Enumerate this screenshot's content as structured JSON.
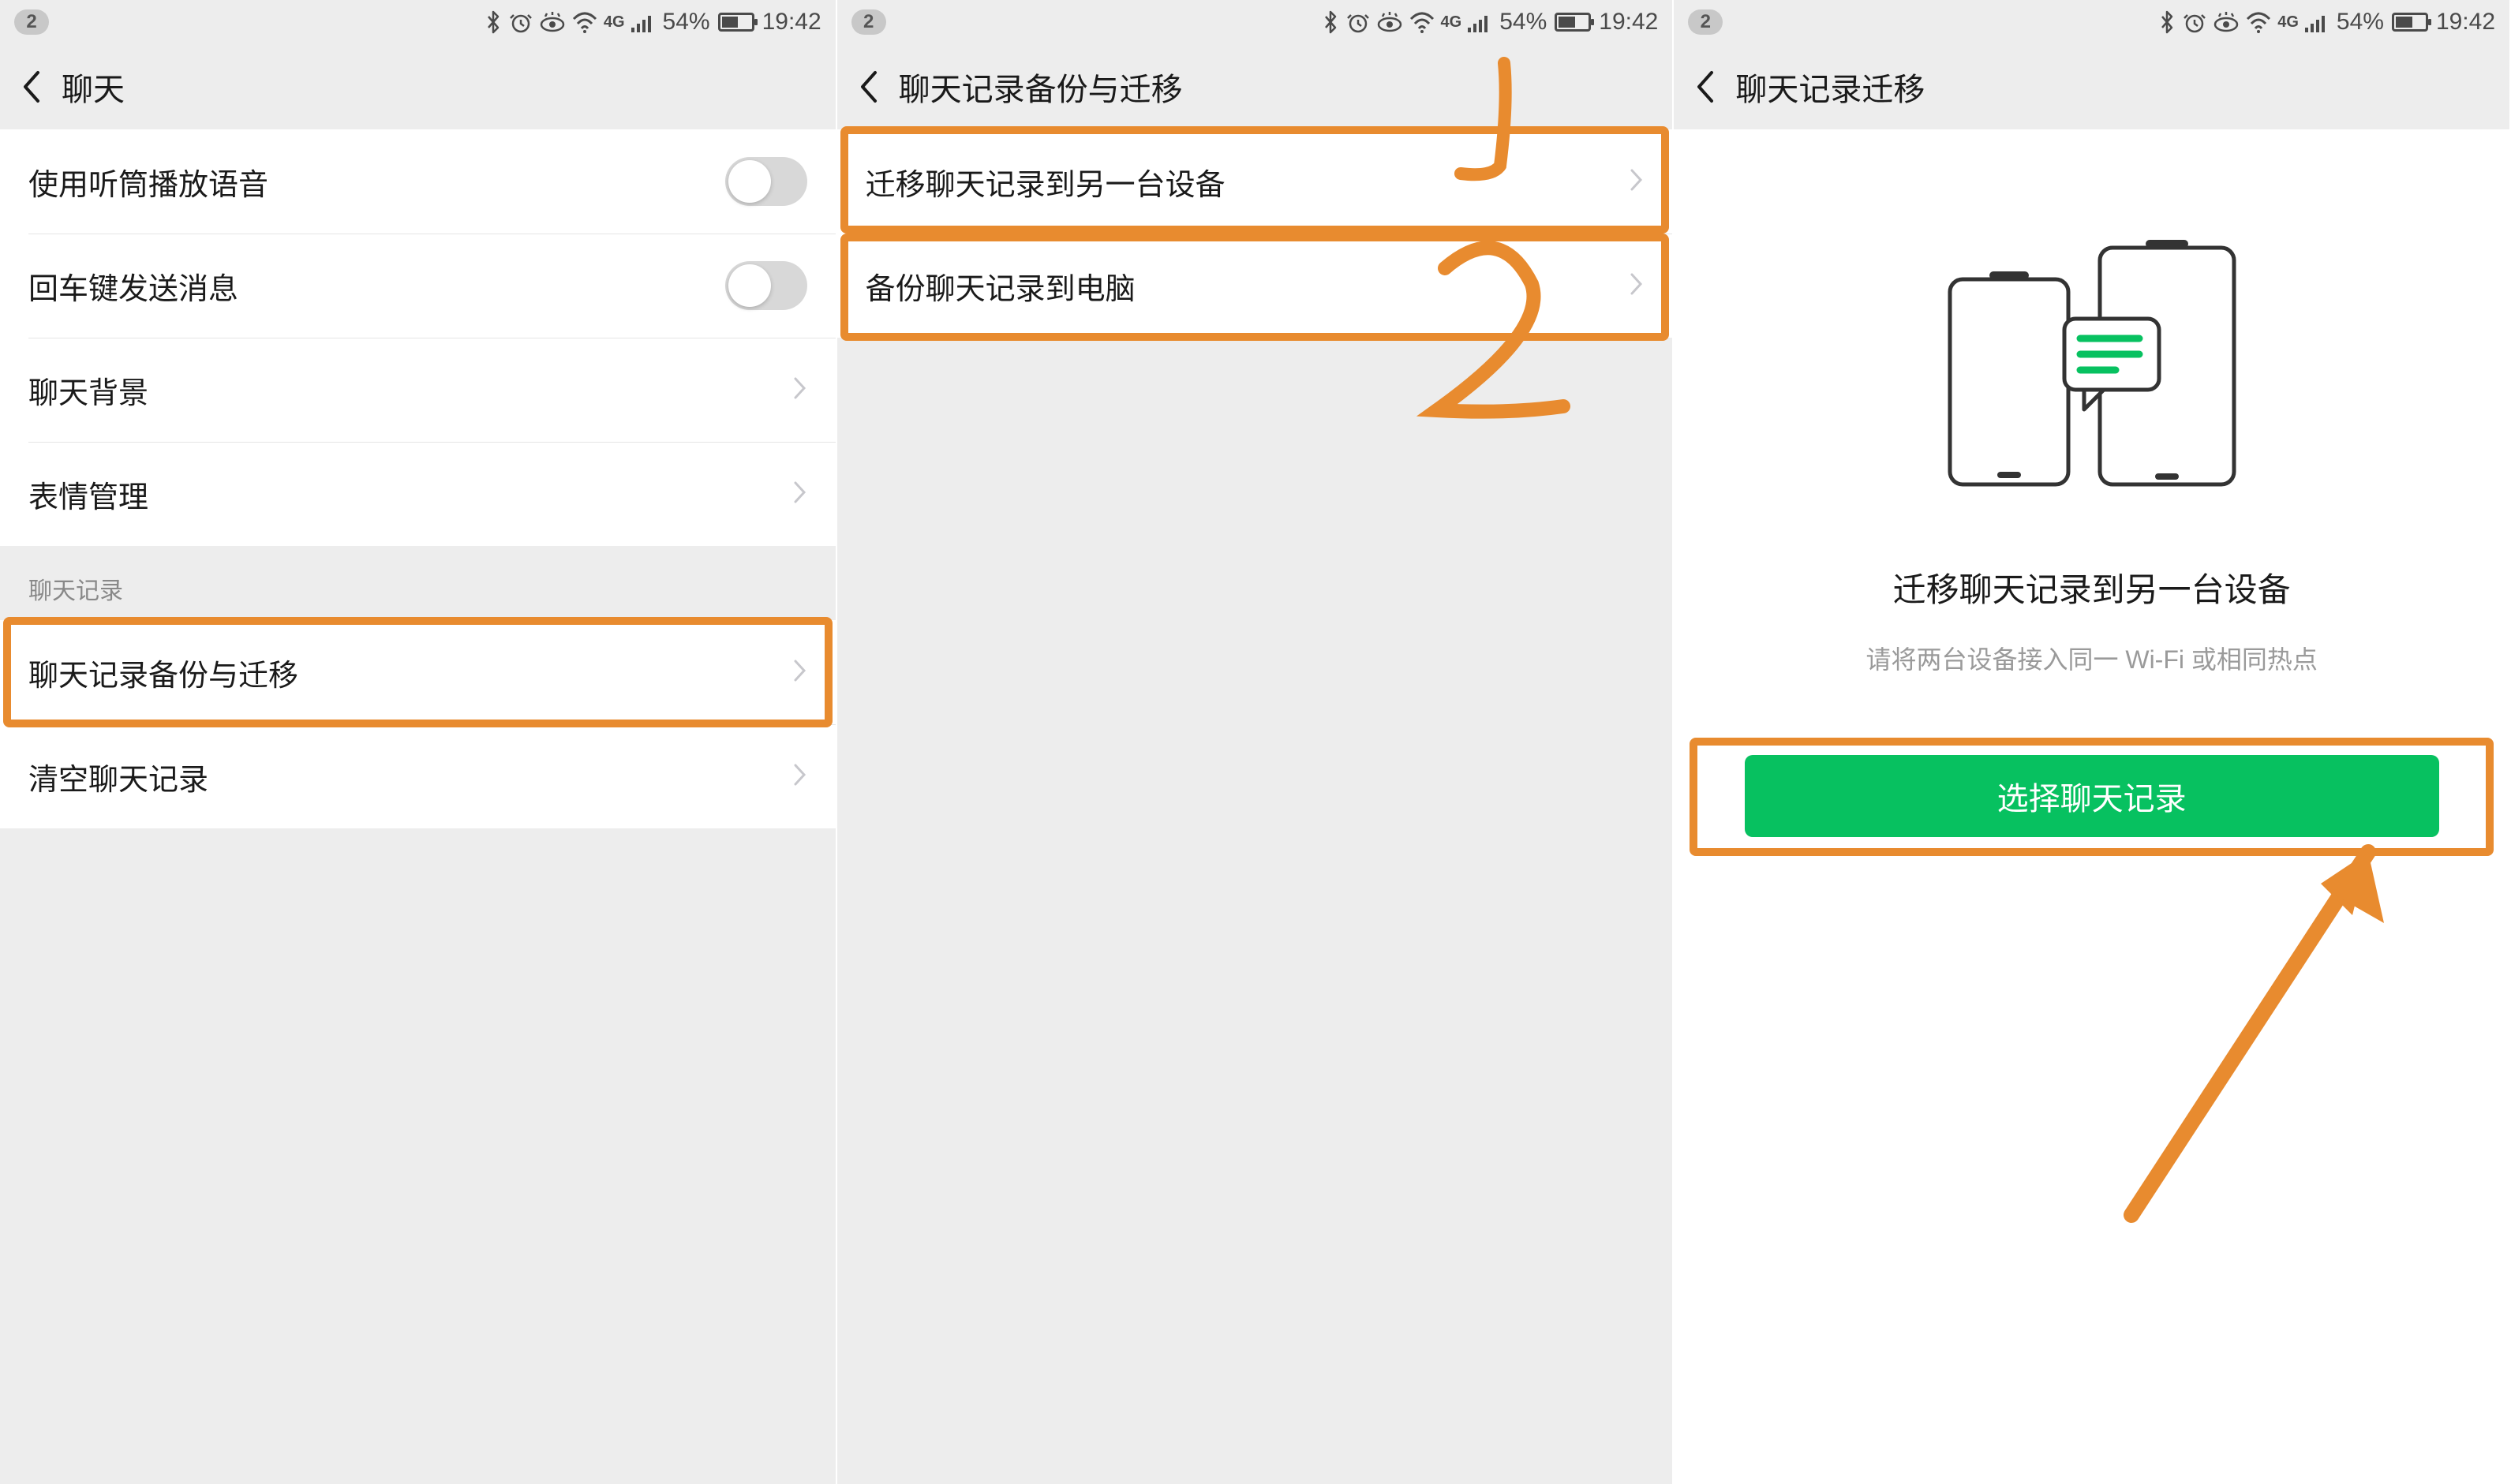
{
  "status": {
    "notif_count": "2",
    "battery_pct": "54%",
    "time": "19:42",
    "net_label": "4G"
  },
  "panel1": {
    "title": "聊天",
    "row_speaker": "使用听筒播放语音",
    "row_enter_send": "回车键发送消息",
    "row_chat_bg": "聊天背景",
    "row_emoji": "表情管理",
    "section_header": "聊天记录",
    "row_backup_migrate": "聊天记录备份与迁移",
    "row_clear": "清空聊天记录"
  },
  "panel2": {
    "title": "聊天记录备份与迁移",
    "row_migrate_device": "迁移聊天记录到另一台设备",
    "row_backup_pc": "备份聊天记录到电脑",
    "ann1": "1",
    "ann2": "2"
  },
  "panel3": {
    "title": "聊天记录迁移",
    "hero_title": "迁移聊天记录到另一台设备",
    "hero_sub": "请将两台设备接入同一 Wi-Fi 或相同热点",
    "button_label": "选择聊天记录"
  }
}
